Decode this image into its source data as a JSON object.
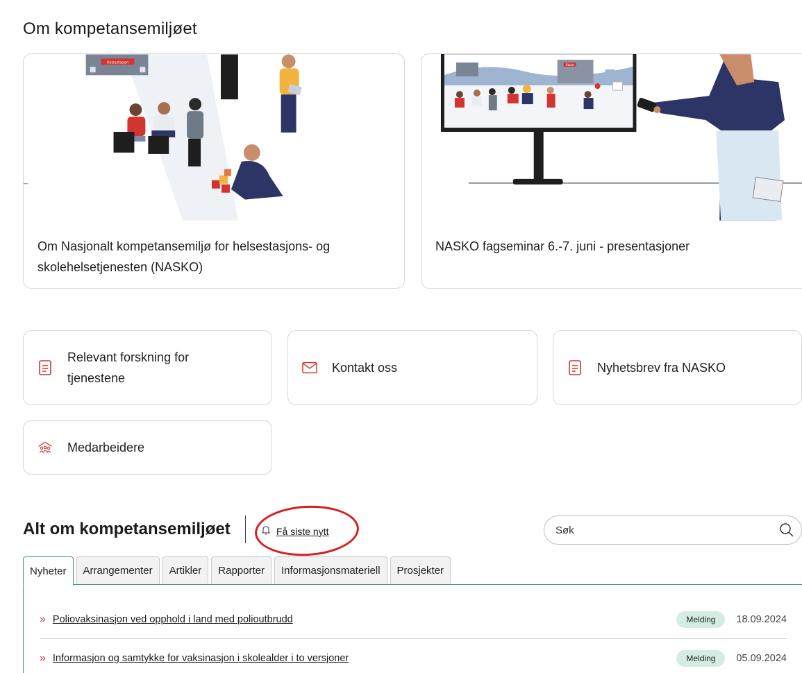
{
  "section": {
    "title": "Om kompetansemiljøet"
  },
  "hero_cards": [
    {
      "text": "Om Nasjonalt kompetansemiljø for helsestasjons- og skolehelsetjenesten (NASKO)"
    },
    {
      "text": "NASKO fagseminar 6.-7. juni - presentasjoner"
    }
  ],
  "illustration_labels": {
    "building_sign": "Helsestasjon",
    "school_sign": "Skole"
  },
  "link_cards": [
    {
      "label": "Relevant forskning for tjenestene",
      "icon": "document-icon"
    },
    {
      "label": "Kontakt oss",
      "icon": "envelope-icon"
    },
    {
      "label": "Nyhetsbrev fra NASKO",
      "icon": "document-icon"
    },
    {
      "label": "Medarbeidere",
      "icon": "people-house-icon"
    }
  ],
  "alt": {
    "title": "Alt om kompetansemiljøet",
    "news_link": "Få siste nytt",
    "search_placeholder": "Søk"
  },
  "tabs": [
    "Nyheter",
    "Arrangementer",
    "Artikler",
    "Rapporter",
    "Informasjonsmateriell",
    "Prosjekter"
  ],
  "active_tab": "Nyheter",
  "news": [
    {
      "title": "Poliovaksinasjon ved opphold i land med polioutbrudd",
      "badge": "Melding",
      "date": "18.09.2024"
    },
    {
      "title": "Informasjon og samtykke for vaksinasjon i skolealder i to versjoner",
      "badge": "Melding",
      "date": "05.09.2024"
    }
  ],
  "colors": {
    "accent_red": "#d2352f",
    "accent_green": "#3d9b72",
    "badge_bg": "#d4ece2",
    "annotation_red": "#d71e1e"
  }
}
